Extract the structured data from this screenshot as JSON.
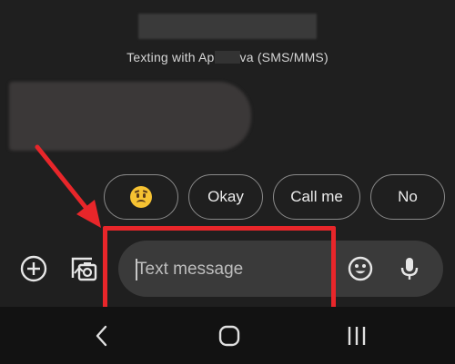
{
  "header": {
    "subtitle_prefix": "Texting with Ap",
    "subtitle_suffix": "va (SMS/MMS)"
  },
  "suggestions": [
    {
      "label": "",
      "icon": "worried-face-emoji"
    },
    {
      "label": "Okay"
    },
    {
      "label": "Call me"
    },
    {
      "label": "No"
    }
  ],
  "compose": {
    "placeholder": "Text message",
    "icons": [
      "add-icon",
      "gallery-camera-icon",
      "emoji-icon",
      "microphone-icon"
    ]
  },
  "navbar": {
    "icons": [
      "back-icon",
      "home-icon",
      "recents-icon"
    ]
  },
  "annotation": {
    "color": "#e8262a"
  }
}
